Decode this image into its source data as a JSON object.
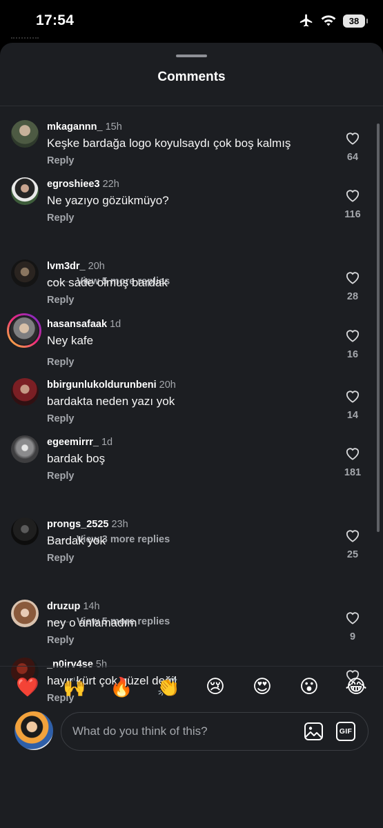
{
  "status": {
    "time": "17:54",
    "battery": "38"
  },
  "sheet": {
    "title": "Comments"
  },
  "comments": [
    {
      "user": "mkagannn_",
      "time": "15h",
      "text": "Keşke bardağa logo koyulsaydı çok boş kalmış",
      "reply": "Reply",
      "likes": "64"
    },
    {
      "user": "egroshiee3",
      "time": "22h",
      "text": "Ne yazıyo gözükmüyo?",
      "reply": "Reply",
      "likes": "116",
      "more_replies": "View 5 more replies"
    },
    {
      "user": "lvm3dr_",
      "time": "20h",
      "text": "cok sade olmuş bardak",
      "reply": "Reply",
      "likes": "28"
    },
    {
      "user": "hasansafaak",
      "time": "1d",
      "text": "Ney kafe",
      "reply": "Reply",
      "likes": "16"
    },
    {
      "user": "bbirgunlukoldurunbeni",
      "time": "20h",
      "text": "bardakta neden yazı yok",
      "reply": "Reply",
      "likes": "14"
    },
    {
      "user": "egeemirrr_",
      "time": "1d",
      "text": "bardak boş",
      "reply": "Reply",
      "likes": "181",
      "more_replies": "View 3 more replies"
    },
    {
      "user": "prongs_2525",
      "time": "23h",
      "text": "Bardak yok",
      "reply": "Reply",
      "likes": "25",
      "more_replies": "View 5 more replies"
    },
    {
      "user": "druzup",
      "time": "14h",
      "text": "ney o anlamadım",
      "reply": "Reply",
      "likes": "9"
    },
    {
      "user": "_n0irv4se",
      "time": "5h",
      "text": "hayır kürt çok güzel değil",
      "reply": "Reply",
      "likes": ""
    }
  ],
  "emojis": [
    "❤️",
    "🙌",
    "🔥",
    "👏",
    "😢",
    "😍",
    "😮",
    "😂"
  ],
  "composer": {
    "placeholder": "What do you think of this?",
    "gif_label": "GIF"
  },
  "icons": {
    "status": [
      "airplane-icon",
      "wifi-icon",
      "battery-icon"
    ],
    "comment": [
      "avatar",
      "heart-icon"
    ],
    "composer": [
      "image-icon",
      "gif-icon"
    ]
  }
}
